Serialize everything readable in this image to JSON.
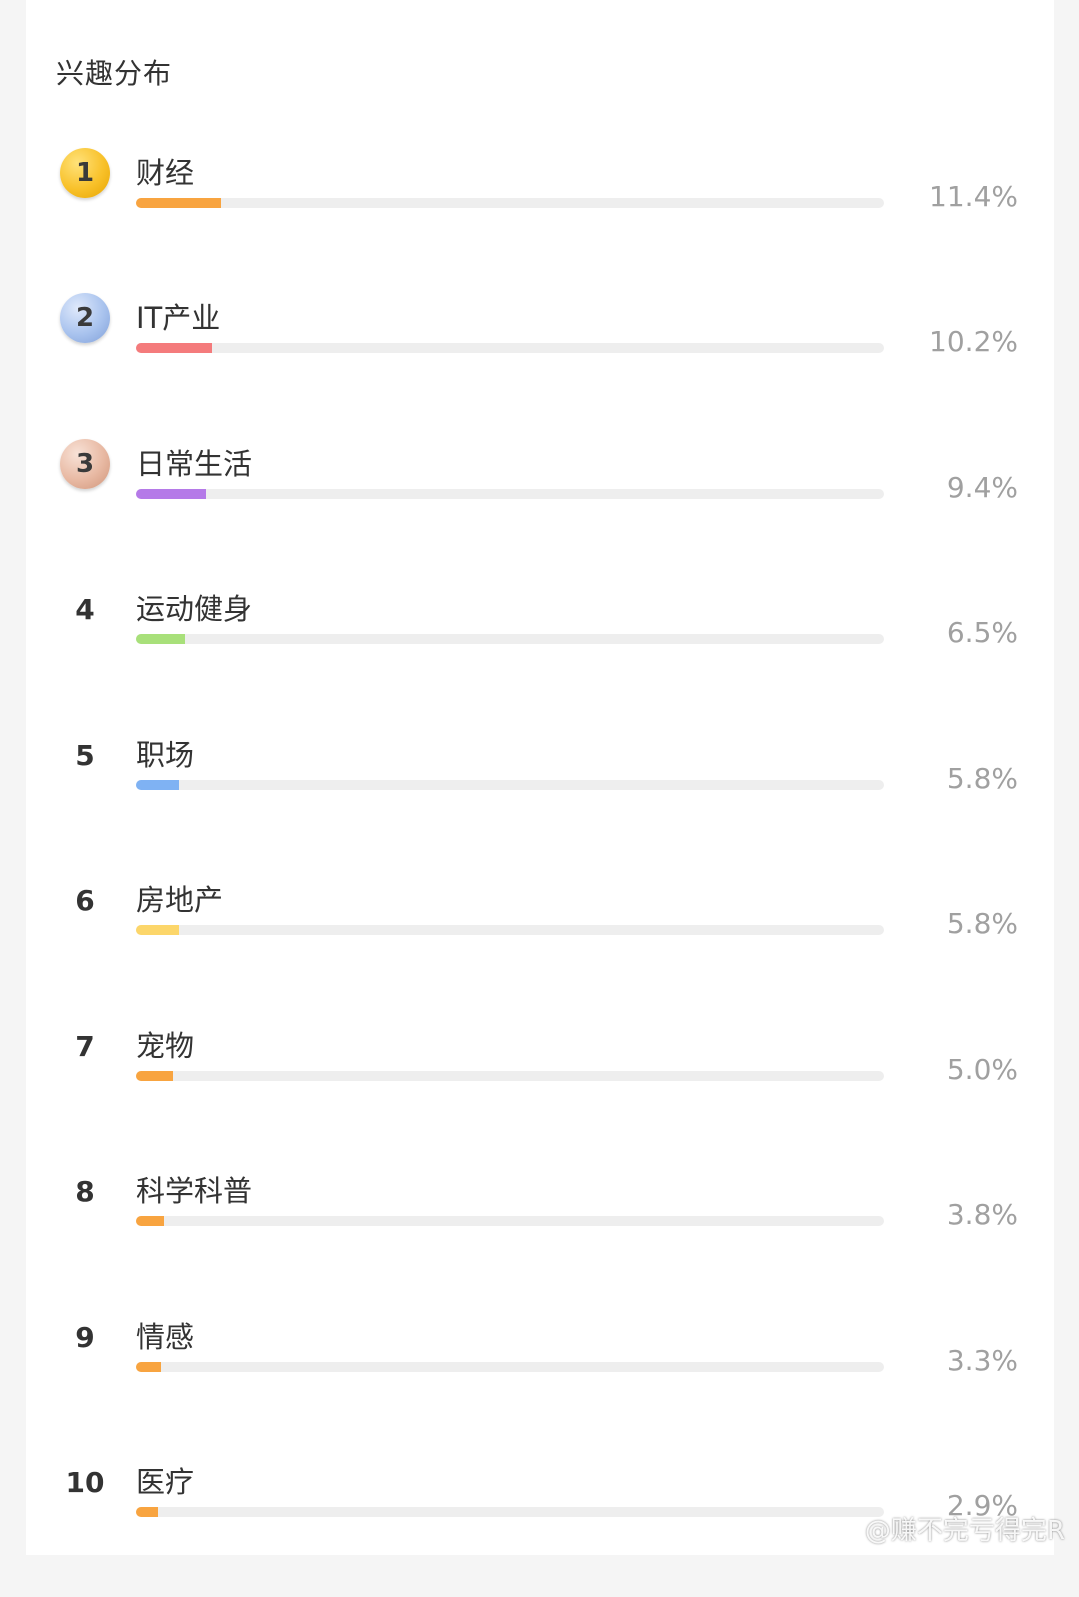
{
  "title": "兴趣分布",
  "colors": {
    "gold_medal": "#f8c12a",
    "silver_medal": "#a9c3ee",
    "bronze_medal": "#e8b9a3",
    "track": "#eeeeee"
  },
  "items": [
    {
      "rank": "1",
      "label": "财经",
      "percent_text": "11.4%",
      "fill_fraction": 0.114,
      "color": "#f8a440",
      "medal": "gold"
    },
    {
      "rank": "2",
      "label": "IT产业",
      "percent_text": "10.2%",
      "fill_fraction": 0.102,
      "color": "#f47b7c",
      "medal": "silver"
    },
    {
      "rank": "3",
      "label": "日常生活",
      "percent_text": "9.4%",
      "fill_fraction": 0.094,
      "color": "#b57ae8",
      "medal": "bronze"
    },
    {
      "rank": "4",
      "label": "运动健身",
      "percent_text": "6.5%",
      "fill_fraction": 0.065,
      "color": "#a8e07a",
      "medal": ""
    },
    {
      "rank": "5",
      "label": "职场",
      "percent_text": "5.8%",
      "fill_fraction": 0.058,
      "color": "#7fb2f3",
      "medal": ""
    },
    {
      "rank": "6",
      "label": "房地产",
      "percent_text": "5.8%",
      "fill_fraction": 0.058,
      "color": "#fcd66a",
      "medal": ""
    },
    {
      "rank": "7",
      "label": "宠物",
      "percent_text": "5.0%",
      "fill_fraction": 0.05,
      "color": "#f8a440",
      "medal": ""
    },
    {
      "rank": "8",
      "label": "科学科普",
      "percent_text": "3.8%",
      "fill_fraction": 0.038,
      "color": "#f8a440",
      "medal": ""
    },
    {
      "rank": "9",
      "label": "情感",
      "percent_text": "3.3%",
      "fill_fraction": 0.033,
      "color": "#f8a440",
      "medal": ""
    },
    {
      "rank": "10",
      "label": "医疗",
      "percent_text": "2.9%",
      "fill_fraction": 0.029,
      "color": "#f8a440",
      "medal": ""
    }
  ],
  "watermark": {
    "text": "@赚不完亏得完R",
    "icon": "weibo-icon"
  }
}
